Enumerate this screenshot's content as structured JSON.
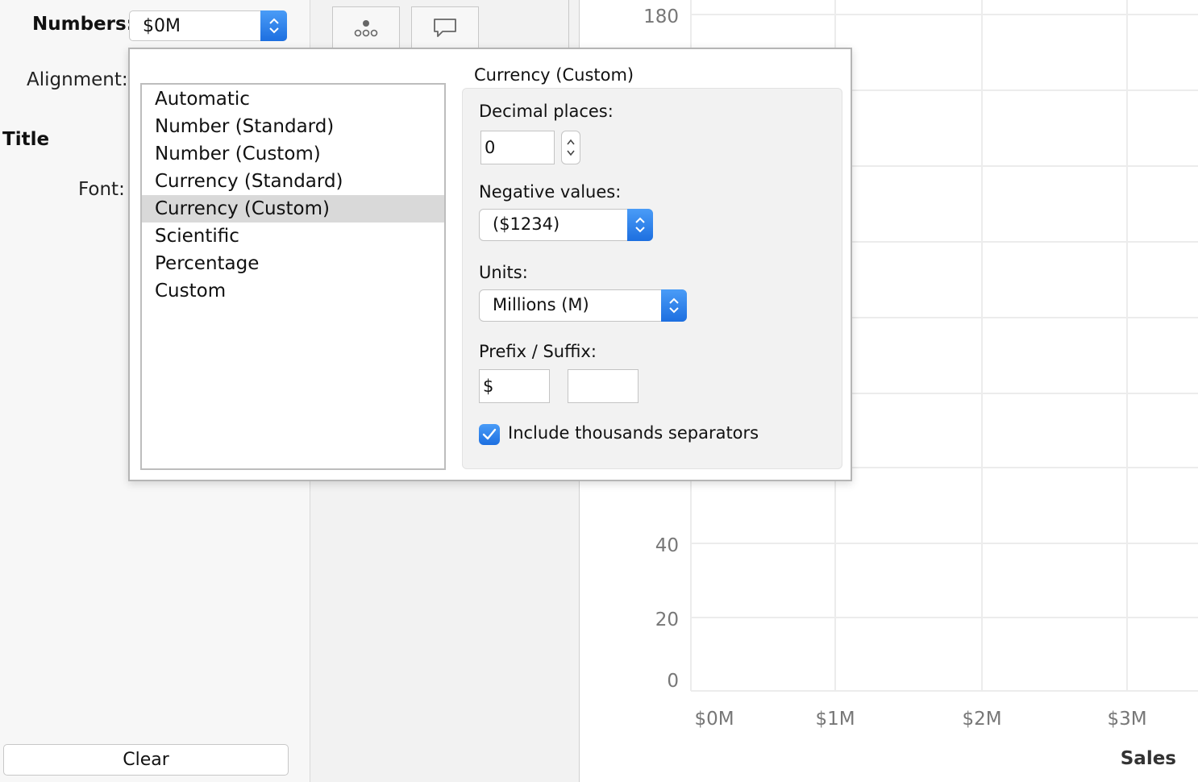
{
  "format_pane": {
    "numbers_label": "Numbers:",
    "numbers_value": "$0M",
    "alignment_label": "Alignment:",
    "title_label": "Title",
    "font_label": "Font:",
    "clear_button": "Clear"
  },
  "number_format_popup": {
    "formats": [
      "Automatic",
      "Number (Standard)",
      "Number (Custom)",
      "Currency (Standard)",
      "Currency (Custom)",
      "Scientific",
      "Percentage",
      "Custom"
    ],
    "selected_format": "Currency (Custom)",
    "section_title": "Currency (Custom)",
    "decimal_places_label": "Decimal places:",
    "decimal_places_value": "0",
    "negative_values_label": "Negative values:",
    "negative_values_value": "($1234)",
    "units_label": "Units:",
    "units_value": "Millions (M)",
    "prefix_suffix_label": "Prefix / Suffix:",
    "prefix_value": "$",
    "suffix_value": "",
    "thousands_separator_label": "Include thousands separators",
    "thousands_separator_checked": true
  },
  "chart_data": {
    "type": "scatter",
    "y_ticks": [
      "0",
      "20",
      "40",
      "180"
    ],
    "x_ticks": [
      "$0M",
      "$1M",
      "$2M",
      "$3M"
    ],
    "xlabel": "Sales",
    "grid": true
  },
  "colors": {
    "accent": "#2f80ed",
    "selection": "#d9d9d9",
    "grid": "#ececec"
  }
}
